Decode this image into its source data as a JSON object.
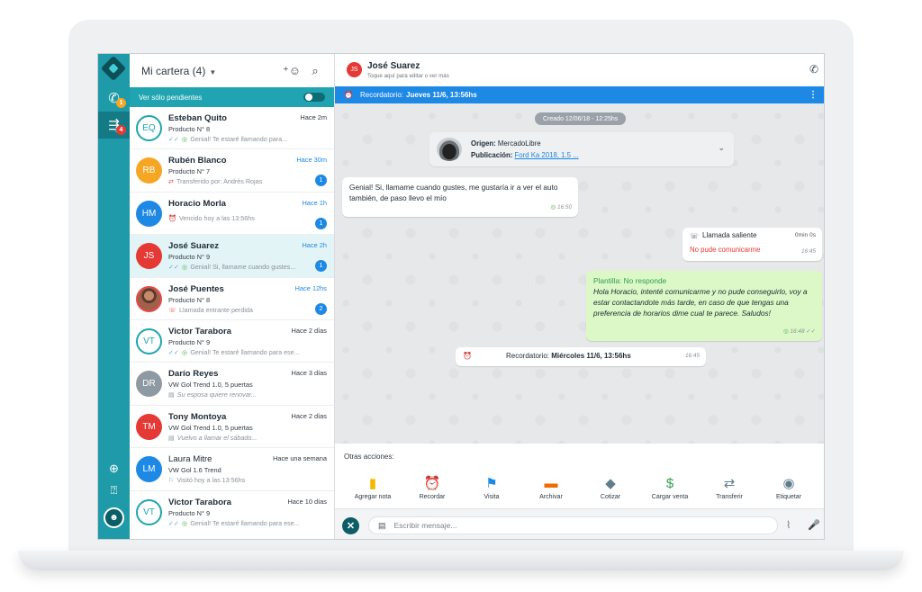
{
  "rail": {
    "badges": {
      "whatsapp": "1",
      "leads": "4"
    },
    "icons": [
      "app-logo",
      "whatsapp-icon",
      "leads-icon",
      "globe-icon",
      "help-icon",
      "user-avatar"
    ]
  },
  "list": {
    "title": "Mi cartera (4)",
    "pending_label": "Ver sólo pendientes",
    "contacts": [
      {
        "initials": "EQ",
        "name": "Esteban Quito",
        "time": "Hace 2m",
        "product": "Producto N° 8",
        "last": "Genial! Te estaré llamando para...",
        "count": ""
      },
      {
        "initials": "RB",
        "name": "Rubén Blanco",
        "time": "Hace 30m",
        "product": "Producto N° 7",
        "last": "Transferido por: Andrés Rojas",
        "count": "1"
      },
      {
        "initials": "HM",
        "name": "Horacio Morla",
        "time": "Hace 1h",
        "product": "",
        "last": "Vencido hoy a las 13:56hs",
        "count": "1"
      },
      {
        "initials": "JS",
        "name": "José Suarez",
        "time": "Hace 2h",
        "product": "Producto N° 9",
        "last": "Genial! Si, llamame cuando gustes...",
        "count": "1"
      },
      {
        "initials": "",
        "name": "José Puentes",
        "time": "Hace 12hs",
        "product": "Producto N° 8",
        "last": "Llamada entrante perdida",
        "count": "2"
      },
      {
        "initials": "VT",
        "name": "Victor Tarabora",
        "time": "Hace 2 días",
        "product": "Producto N° 9",
        "last": "Genial! Te estaré llamando para ese...",
        "count": ""
      },
      {
        "initials": "DR",
        "name": "Darío Reyes",
        "time": "Hace 3 días",
        "product": "VW Gol Trend 1.0, 5 puertas",
        "last": "Su esposa quiere renovar...",
        "count": ""
      },
      {
        "initials": "TM",
        "name": "Tony Montoya",
        "time": "Hace 2 días",
        "product": "VW Gol Trend 1.0, 5 puertas",
        "last": "Vuelvo a llamar el sábado...",
        "count": ""
      },
      {
        "initials": "LM",
        "name": "Laura Mitre",
        "time": "Hace una semana",
        "product": "VW Gol 1.6 Trend",
        "last": "Visitó hoy a las 13:56hs",
        "count": ""
      },
      {
        "initials": "VT",
        "name": "Victor Tarabora",
        "time": "Hace 10 días",
        "product": "Producto N° 9",
        "last": "Genial! Te estaré llamando para ese...",
        "count": ""
      }
    ]
  },
  "chat": {
    "header": {
      "initials": "JS",
      "name": "José Suarez",
      "subtitle": "Toque aquí para editar o ver más"
    },
    "reminder": {
      "label": "Recordatorio:",
      "value": "Jueves 11/6, 13:56hs"
    },
    "date_pill": "Creado 12/06/18 - 12:25hs",
    "origin": {
      "label": "Origen:",
      "value": "MercadoLibre",
      "pub_label": "Publicación:",
      "pub_link": "Ford Ka 2018, 1.5 ..."
    },
    "msg1": {
      "text": "Genial! Si, llamame cuando gustes, me gustaría ir a ver el auto también, de paso llevo el mío",
      "time": "16:50"
    },
    "call": {
      "title": "Llamada saliente",
      "duration": "0min 0s",
      "status": "No pude comunicarme",
      "time": "16:45"
    },
    "template": {
      "title": "Plantilla: No responde",
      "text": "Hola Horacio, intenté comunicarme y no pude conseguirlo, voy a estar contactandote más tarde, en caso de que tengas una preferencia de horarios dime cual te parece. Saludos!",
      "time": "16:48"
    },
    "reminder_bubble": {
      "label": "Recordatorio:",
      "value": "Miércoles 11/6, 13:56hs",
      "time": "16:45"
    },
    "actions_title": "Otras acciones:",
    "actions": [
      {
        "label": "Agregar nota",
        "icon": "note-icon",
        "color": "#f5b800"
      },
      {
        "label": "Recordar",
        "icon": "alarm-icon",
        "color": "#1e88e5"
      },
      {
        "label": "Visita",
        "icon": "walk-icon",
        "color": "#1e88e5"
      },
      {
        "label": "Archivar",
        "icon": "archive-icon",
        "color": "#ef6c00"
      },
      {
        "label": "Cotizar",
        "icon": "tag-icon",
        "color": "#607d8b"
      },
      {
        "label": "Cargar venta",
        "icon": "money-tag-icon",
        "color": "#2e9e4f"
      },
      {
        "label": "Transferir",
        "icon": "transfer-icon",
        "color": "#607d8b"
      },
      {
        "label": "Etiquetar",
        "icon": "label-icon",
        "color": "#607d8b"
      }
    ],
    "composer_placeholder": "Escribir mensaje..."
  },
  "colors": {
    "accent": "#20a4b1",
    "reminder": "#1e88e5",
    "rail": "#1f9aa8"
  }
}
